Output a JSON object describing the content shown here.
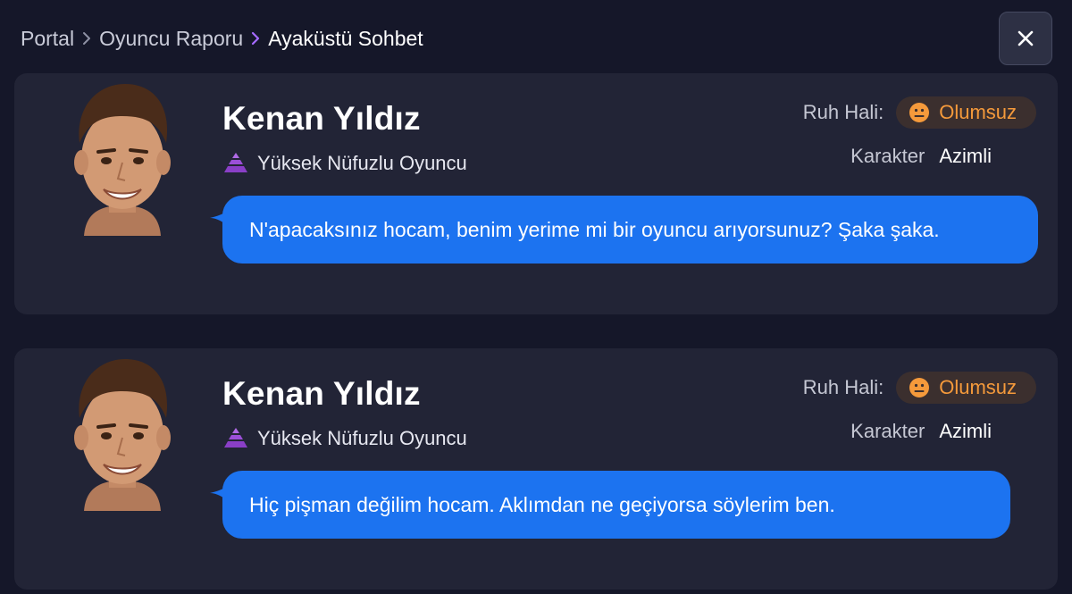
{
  "breadcrumb": {
    "items": [
      "Portal",
      "Oyuncu Raporu"
    ],
    "current": "Ayaküstü Sohbet"
  },
  "close_icon": "close-icon",
  "cards": [
    {
      "name": "Kenan Yıldız",
      "status": "Yüksek Nüfuzlu Oyuncu",
      "mood_label": "Ruh Hali:",
      "mood_value": "Olumsuz",
      "character_label": "Karakter",
      "character_value": "Azimli",
      "message": "N'apacaksınız hocam, benim yerime mi bir oyuncu arıyorsunuz? Şaka şaka."
    },
    {
      "name": "Kenan Yıldız",
      "status": "Yüksek Nüfuzlu Oyuncu",
      "mood_label": "Ruh Hali:",
      "mood_value": "Olumsuz",
      "character_label": "Karakter",
      "character_value": "Azimli",
      "message": "Hiç pişman değilim hocam. Aklımdan ne geçiyorsa söylerim ben."
    }
  ],
  "colors": {
    "background": "#151729",
    "card": "#222436",
    "bubble": "#1c73f0",
    "mood_text": "#f59a3b",
    "mood_pill": "#3b2f2e",
    "status_icon": "#9b4fd8"
  }
}
